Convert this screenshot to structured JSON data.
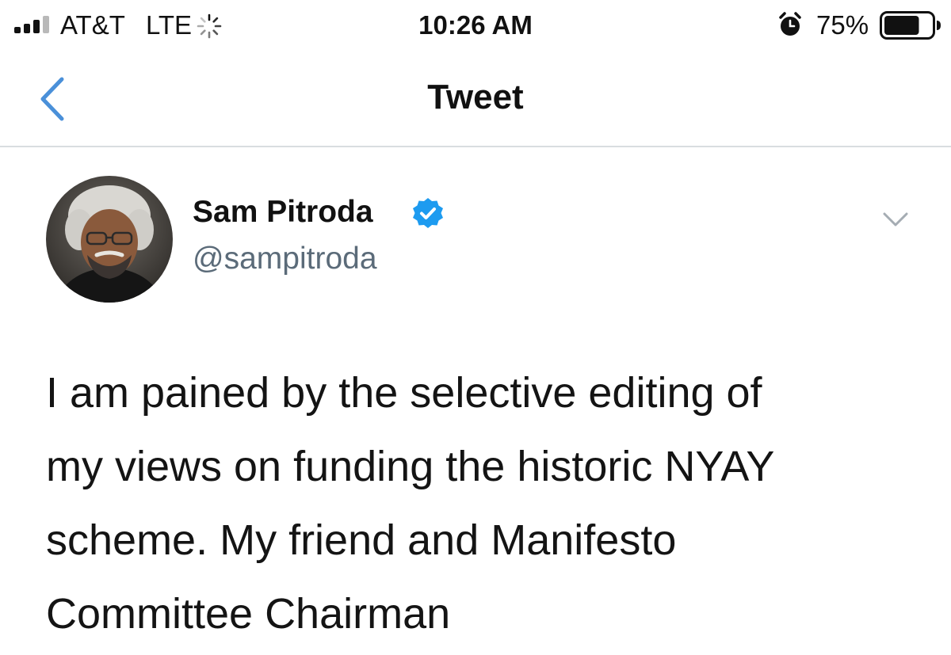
{
  "status_bar": {
    "carrier": "AT&T",
    "network": "LTE",
    "time": "10:26 AM",
    "battery_percent": "75%",
    "signal_icon": "signal-bars-icon",
    "activity_icon": "activity-spinner-icon",
    "alarm_icon": "alarm-clock-icon",
    "battery_icon": "battery-icon",
    "battery_level": 0.75
  },
  "nav": {
    "title": "Tweet",
    "back_icon": "chevron-left-icon",
    "accent_color": "#4a90d9"
  },
  "tweet": {
    "author_name": "Sam Pitroda",
    "author_handle": "@sampitroda",
    "verified_icon": "verified-badge-icon",
    "more_icon": "chevron-down-icon",
    "text_lines": [
      "I am pained by the selective editing of",
      "my views on funding the historic NYAY",
      "scheme. My friend and Manifesto",
      "Committee Chairman"
    ]
  },
  "colors": {
    "handle": "#5b6b79",
    "verified": "#1d9bf0",
    "divider": "#d9dde0"
  }
}
